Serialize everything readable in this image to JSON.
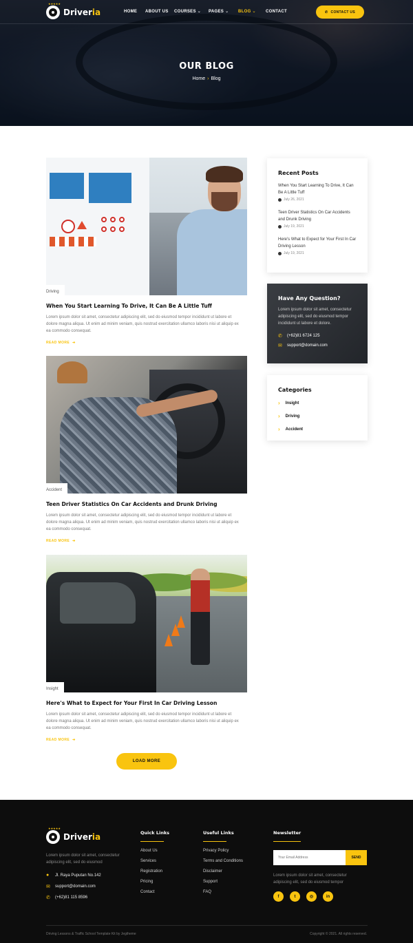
{
  "brand": {
    "name_main": "Driver",
    "name_accent": "ia",
    "stars": "★★★★★"
  },
  "nav": [
    {
      "label": "HOME",
      "has_dropdown": false
    },
    {
      "label": "ABOUT US",
      "has_dropdown": false
    },
    {
      "label": "COURSES",
      "has_dropdown": true
    },
    {
      "label": "PAGES",
      "has_dropdown": true
    },
    {
      "label": "BLOG",
      "has_dropdown": true,
      "active": true
    },
    {
      "label": "CONTACT",
      "has_dropdown": false
    }
  ],
  "header_button": {
    "label": "CONTACT US",
    "icon": "phone-icon"
  },
  "hero": {
    "title": "OUR BLOG",
    "breadcrumb": [
      "Home",
      "Blog"
    ]
  },
  "posts": [
    {
      "tag": "Driving",
      "title": "When You Start Learning To Drive, It Can Be A Little Tuff",
      "excerpt": "Lorem ipsum dolor sit amet, consectetur adipiscing elit, sed do eiusmod tempor incididunt ut labore et dolore magna aliqua. Ut enim ad minim veniam, quis nostrud exercitation ullamco laboris nisi ut aliquip ex ea commodo consequat.",
      "read_more": "READ MORE"
    },
    {
      "tag": "Accident",
      "title": "Teen Driver Statistics On Car Accidents and Drunk Driving",
      "excerpt": "Lorem ipsum dolor sit amet, consectetur adipiscing elit, sed do eiusmod tempor incididunt ut labore et dolore magna aliqua. Ut enim ad minim veniam, quis nostrud exercitation ullamco laboris nisi ut aliquip ex ea commodo consequat.",
      "read_more": "READ MORE"
    },
    {
      "tag": "Insight",
      "title": "Here's What to Expect for Your First In Car Driving Lesson",
      "excerpt": "Lorem ipsum dolor sit amet, consectetur adipiscing elit, sed do eiusmod tempor incididunt ut labore et dolore magna aliqua. Ut enim ad minim veniam, quis nostrud exercitation ullamco laboris nisi ut aliquip ex ea commodo consequat.",
      "read_more": "READ MORE"
    }
  ],
  "load_more": "LOAD MORE",
  "sidebar": {
    "recent": {
      "title": "Recent Posts",
      "items": [
        {
          "title": "When You Start Learning To Drive, It Can Be A Little Tuff",
          "date": "July 26, 2021"
        },
        {
          "title": "Teen Driver Statistics On Car Accidents and Drunk Driving",
          "date": "July 19, 2021"
        },
        {
          "title": "Here's What to Expect for Your First In Car Driving Lesson",
          "date": "July 19, 2021"
        }
      ]
    },
    "question": {
      "title": "Have Any Question?",
      "text": "Lorem ipsum dolor sit amet, consectetur adipiscing elit, sed do eiusmod tempor incididunt ut labore et dolore.",
      "phone": "(+62)81 6724 125",
      "email": "support@domain.com"
    },
    "categories": {
      "title": "Categories",
      "items": [
        "Insight",
        "Driving",
        "Accident"
      ]
    }
  },
  "footer": {
    "about": "Lorem ipsum dolor sit amet, consectetur adipiscing elit, sed do eiusmod",
    "address": "Jl. Raya Puputan No.142",
    "email": "support@domain.com",
    "phone": "(+62)81 115 8596",
    "quick_links": {
      "title": "Quick Links",
      "items": [
        "About Us",
        "Services",
        "Registration",
        "Pricing",
        "Contact"
      ]
    },
    "useful_links": {
      "title": "Useful Links",
      "items": [
        "Privacy Policy",
        "Terms and Conditions",
        "Disclaimer",
        "Support",
        "FAQ"
      ]
    },
    "newsletter": {
      "title": "Newsletter",
      "placeholder": "Your Email Address",
      "button": "SEND",
      "text": "Lorem ipsum dolor sit amet, consectetur adipiscing elit, sed do eiusmod tempor"
    },
    "socials": [
      "facebook-icon",
      "twitter-icon",
      "instagram-icon",
      "linkedin-icon"
    ],
    "copyright_left": "Driving Lessons & Traffic School Template Kit by Jegtheme",
    "copyright_right": "Copyright © 2021. All rights reserved."
  },
  "colors": {
    "accent": "#f9c40f",
    "dark": "#0d0d0d"
  }
}
